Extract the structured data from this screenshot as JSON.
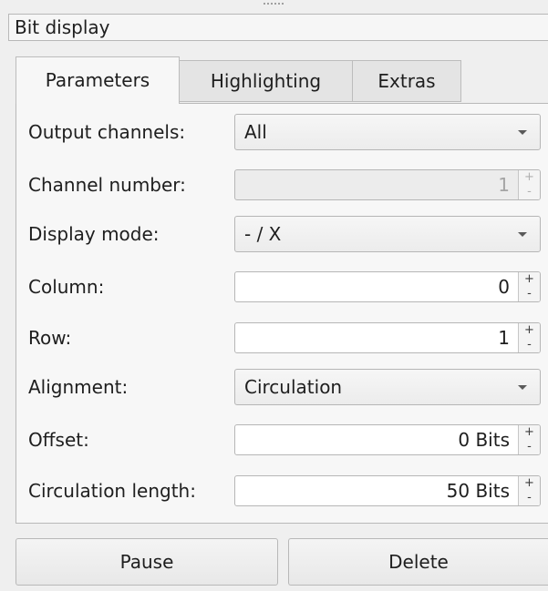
{
  "panel": {
    "title": "Bit display"
  },
  "tabs": [
    {
      "label": "Parameters",
      "active": true
    },
    {
      "label": "Highlighting",
      "active": false
    },
    {
      "label": "Extras",
      "active": false
    }
  ],
  "fields": {
    "output_channels": {
      "label": "Output channels:",
      "value": "All"
    },
    "channel_number": {
      "label": "Channel number:",
      "value": "1",
      "enabled": false
    },
    "display_mode": {
      "label": "Display mode:",
      "value": "- / X"
    },
    "column": {
      "label": "Column:",
      "value": "0"
    },
    "row": {
      "label": "Row:",
      "value": "1"
    },
    "alignment": {
      "label": "Alignment:",
      "value": "Circulation"
    },
    "offset": {
      "label": "Offset:",
      "value": "0 Bits"
    },
    "circulation_length": {
      "label": "Circulation length:",
      "value": "50 Bits"
    }
  },
  "spin_glyphs": {
    "up": "+",
    "down": "-"
  },
  "buttons": {
    "pause": "Pause",
    "delete": "Delete"
  }
}
